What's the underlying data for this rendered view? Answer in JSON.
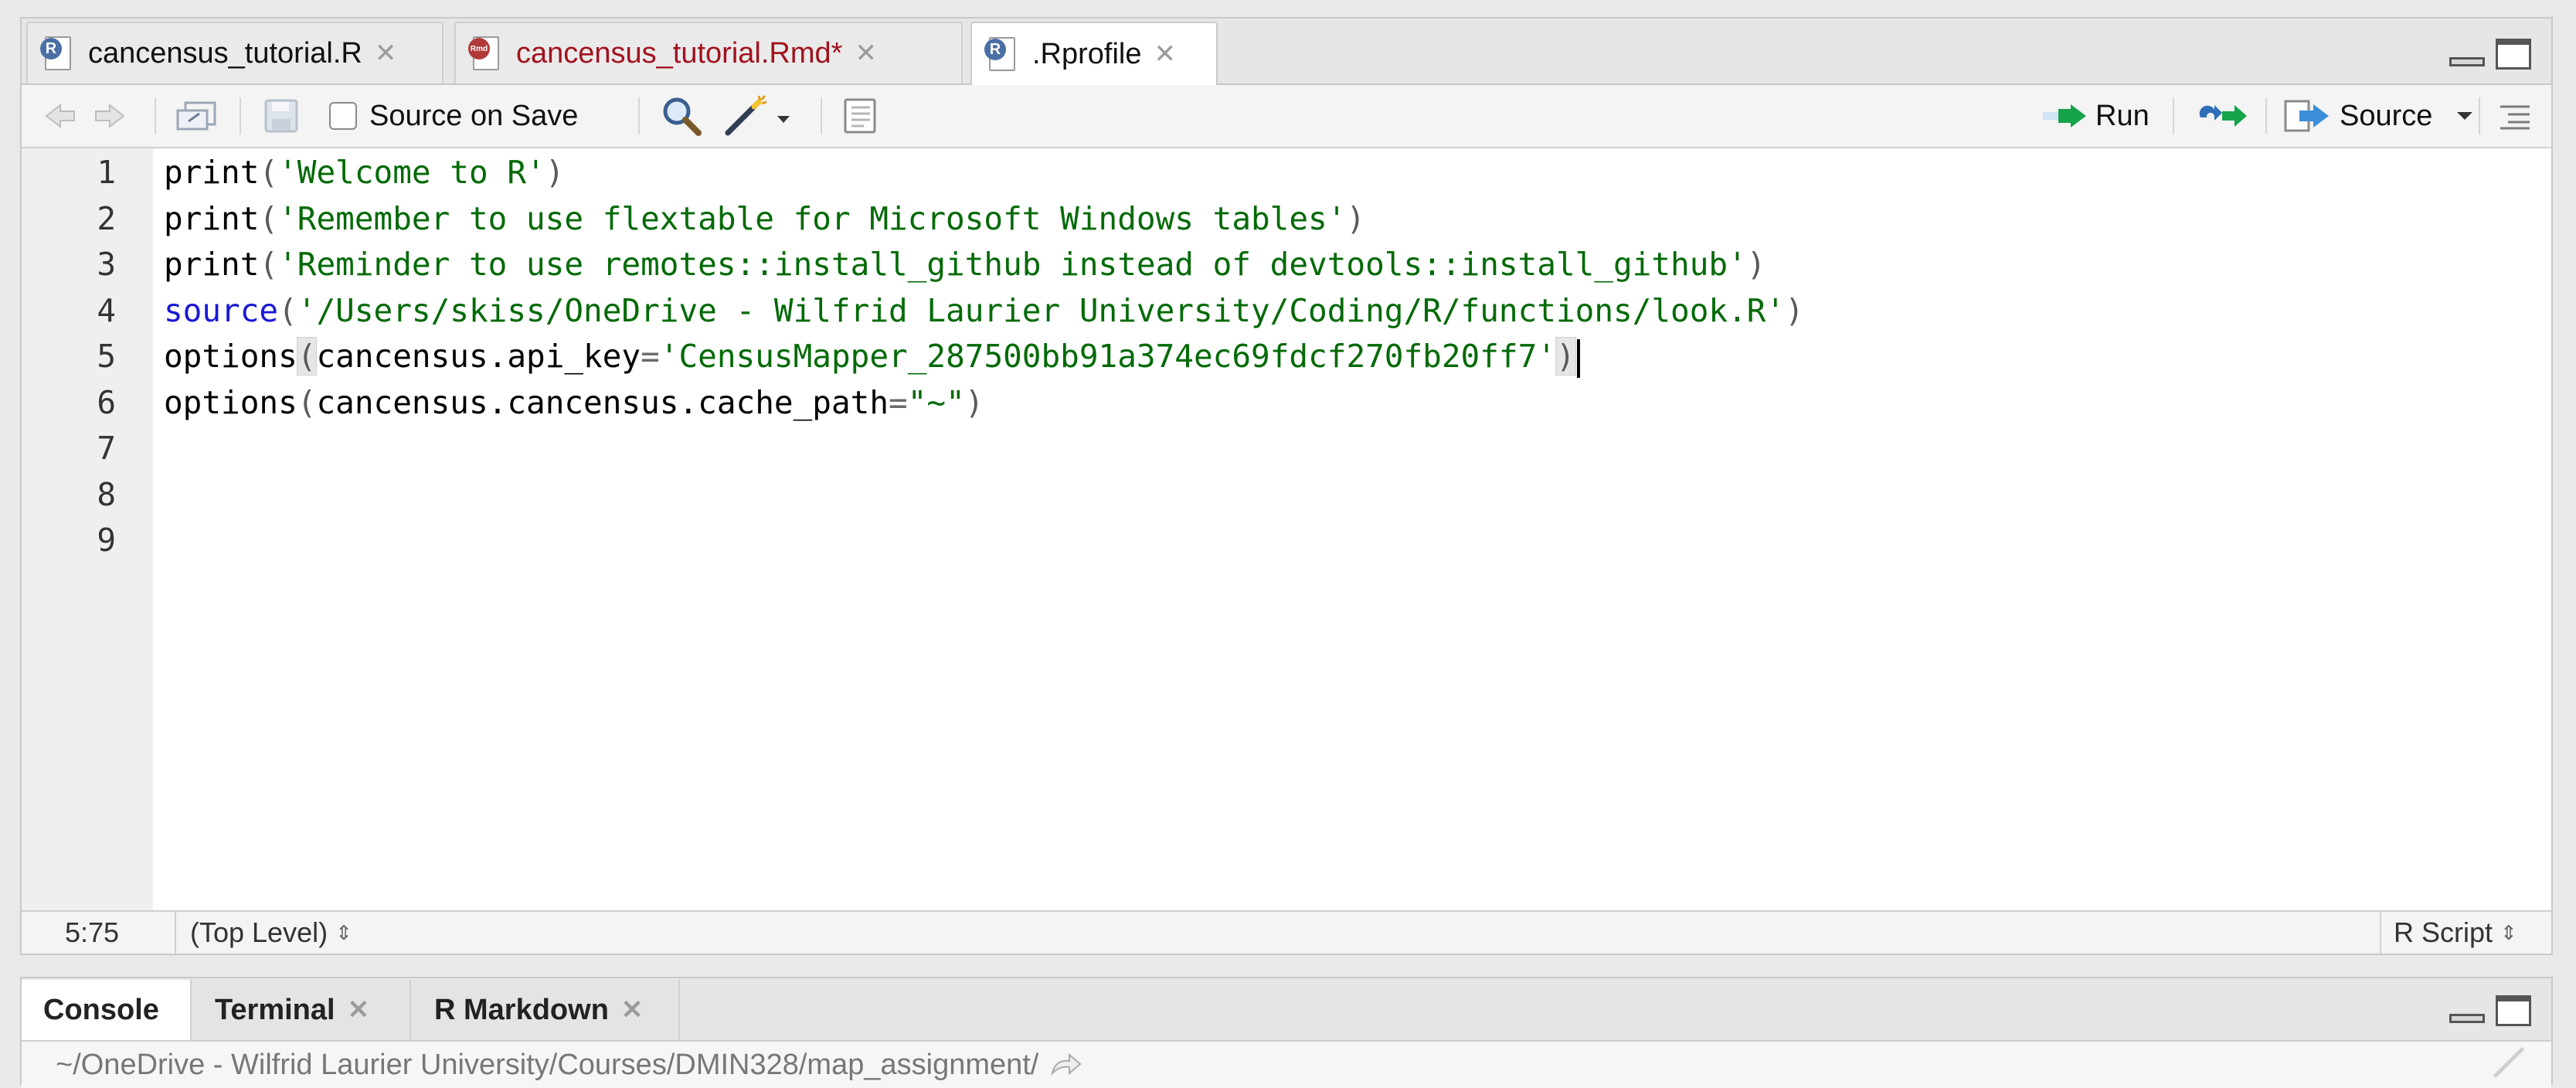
{
  "source_pane": {
    "tabs": [
      {
        "label": "cancensus_tutorial.R",
        "icon": "r-file-icon",
        "modified": false,
        "active": false
      },
      {
        "label": "cancensus_tutorial.Rmd*",
        "icon": "rmd-file-icon",
        "modified": true,
        "active": false
      },
      {
        "label": ".Rprofile",
        "icon": "r-file-icon",
        "modified": false,
        "active": true
      }
    ],
    "icon_badges": {
      "r": "R",
      "rmd": "Rmd"
    },
    "close_glyph": "✕",
    "toolbar": {
      "source_on_save_label": "Source on Save",
      "source_on_save_checked": false,
      "run_label": "Run",
      "source_label": "Source"
    },
    "code_lines": [
      {
        "num": "1",
        "tokens": [
          {
            "t": "fn",
            "v": "print"
          },
          {
            "t": "paren",
            "v": "("
          },
          {
            "t": "str",
            "v": "'Welcome to R'"
          },
          {
            "t": "paren",
            "v": ")"
          }
        ]
      },
      {
        "num": "2",
        "tokens": [
          {
            "t": "fn",
            "v": "print"
          },
          {
            "t": "paren",
            "v": "("
          },
          {
            "t": "str",
            "v": "'Remember to use flextable for Microsoft Windows tables'"
          },
          {
            "t": "paren",
            "v": ")"
          }
        ]
      },
      {
        "num": "3",
        "tokens": [
          {
            "t": "fn",
            "v": "print"
          },
          {
            "t": "paren",
            "v": "("
          },
          {
            "t": "str",
            "v": "'Reminder to use remotes::install_github instead of devtools::install_github'"
          },
          {
            "t": "paren",
            "v": ")"
          }
        ]
      },
      {
        "num": "4",
        "tokens": [
          {
            "t": "kw",
            "v": "source"
          },
          {
            "t": "paren",
            "v": "("
          },
          {
            "t": "str",
            "v": "'/Users/skiss/OneDrive - Wilfrid Laurier University/Coding/R/functions/look.R'"
          },
          {
            "t": "paren",
            "v": ")"
          }
        ]
      },
      {
        "num": "5",
        "tokens": [
          {
            "t": "fn",
            "v": "options"
          },
          {
            "t": "paren-hl",
            "v": "("
          },
          {
            "t": "fn",
            "v": "cancensus.api_key"
          },
          {
            "t": "op",
            "v": "="
          },
          {
            "t": "str",
            "v": "'CensusMapper_287500bb91a374ec69fdcf270fb20ff7'"
          },
          {
            "t": "paren-hl",
            "v": ")"
          },
          {
            "t": "cursor",
            "v": ""
          }
        ]
      },
      {
        "num": "6",
        "tokens": [
          {
            "t": "fn",
            "v": "options"
          },
          {
            "t": "paren",
            "v": "("
          },
          {
            "t": "fn",
            "v": "cancensus.cancensus.cache_path"
          },
          {
            "t": "op",
            "v": "="
          },
          {
            "t": "str",
            "v": "\"~\""
          },
          {
            "t": "paren",
            "v": ")"
          }
        ]
      },
      {
        "num": "7",
        "tokens": []
      },
      {
        "num": "8",
        "tokens": []
      },
      {
        "num": "9",
        "tokens": []
      }
    ],
    "status": {
      "cursor_position": "5:75",
      "scope": "(Top Level)",
      "file_type": "R Script",
      "updown_glyph": "⇕"
    }
  },
  "console_pane": {
    "tabs": [
      {
        "label": "Console",
        "active": true,
        "closable": false
      },
      {
        "label": "Terminal",
        "active": false,
        "closable": true
      },
      {
        "label": "R Markdown",
        "active": false,
        "closable": true
      }
    ],
    "working_dir": "~/OneDrive - Wilfrid Laurier University/Courses/DMIN328/map_assignment/"
  },
  "colors": {
    "keyword": "#1a18d6",
    "string": "#036a07",
    "modified_tab": "#a2121e",
    "run_arrow": "#16a34a",
    "source_arrow": "#3b8ed8"
  }
}
